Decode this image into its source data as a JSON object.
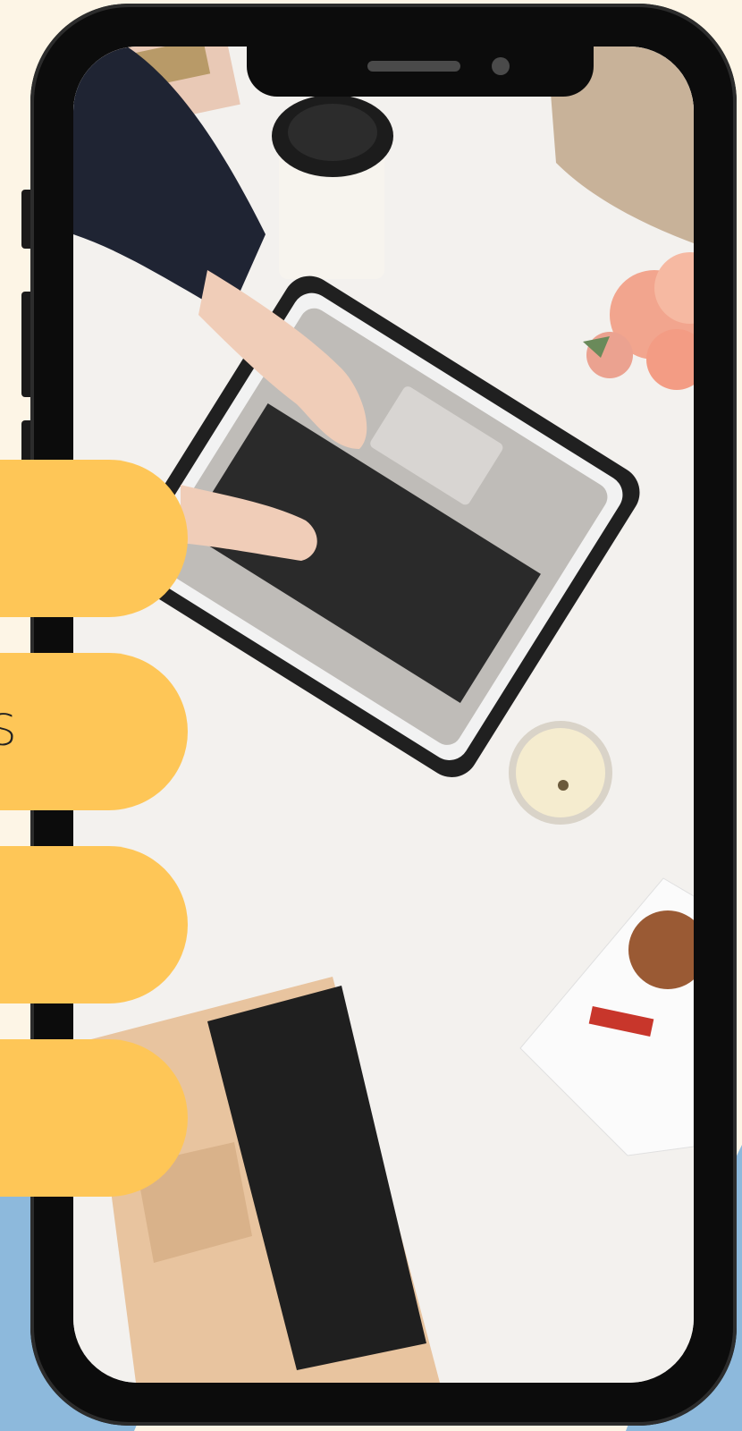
{
  "theme": {
    "background": "#fdf5e6",
    "accent_yellow": "#fec657",
    "wave_blue": "#8db9dc",
    "phone_frame": "#0c0c0c"
  },
  "tabs": [
    {
      "label": ""
    },
    {
      "label": "S"
    },
    {
      "label": ""
    },
    {
      "label": ""
    }
  ],
  "photo": {
    "icons": [
      "laptop-icon",
      "coffee-cup-icon",
      "candle-icon",
      "flowers-icon",
      "pastry-icon"
    ]
  }
}
